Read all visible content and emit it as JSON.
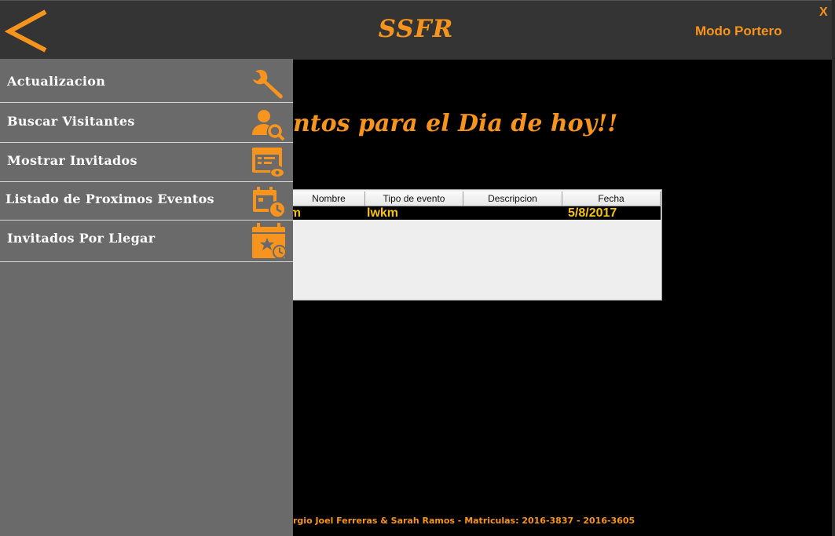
{
  "header": {
    "title": "SSFR",
    "mode_label": "Modo Portero",
    "close_label": "X",
    "back_icon": "chevron-left-icon",
    "accent_color": "#f7941d"
  },
  "main": {
    "headline": "ntos para el Dia de hoy!!",
    "table": {
      "columns": [
        "Nombre",
        "Tipo de evento",
        "Descripcion",
        "Fecha"
      ],
      "rows": [
        {
          "nombre": "nm",
          "tipo": "lwkm",
          "descripcion": "",
          "fecha": "5/8/2017"
        }
      ]
    },
    "footer": "rgio Joel Ferreras & Sarah Ramos - Matriculas: 2016-3837 - 2016-3605"
  },
  "sidebar": {
    "items": [
      {
        "label": "Actualizacion",
        "icon": "wrench-icon"
      },
      {
        "label": "Buscar Visitantes",
        "icon": "user-search-icon"
      },
      {
        "label": "Mostrar Invitados",
        "icon": "list-view-icon"
      },
      {
        "label": "Listado de Proximos Eventos",
        "icon": "calendar-clock-icon"
      },
      {
        "label": "Invitados Por Llegar",
        "icon": "calendar-star-clock-icon"
      }
    ]
  }
}
